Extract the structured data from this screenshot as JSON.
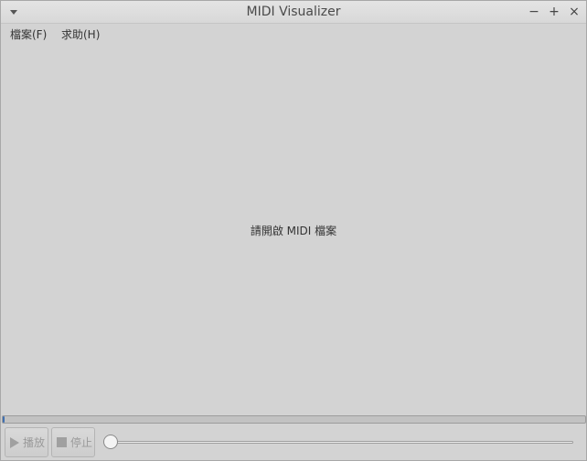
{
  "window": {
    "title": "MIDI Visualizer"
  },
  "titlebar": {
    "minimize": "−",
    "maximize": "+",
    "close": "×"
  },
  "menubar": {
    "items": [
      {
        "label": "檔案(F)"
      },
      {
        "label": "求助(H)"
      }
    ]
  },
  "canvas": {
    "placeholder": "請開啟 MIDI 檔案"
  },
  "playback": {
    "progress": 0.002,
    "position": 0.0,
    "play_label": "播放",
    "stop_label": "停止"
  },
  "colors": {
    "progress_fill": "#3f6fb0",
    "background": "#d3d3d3"
  }
}
